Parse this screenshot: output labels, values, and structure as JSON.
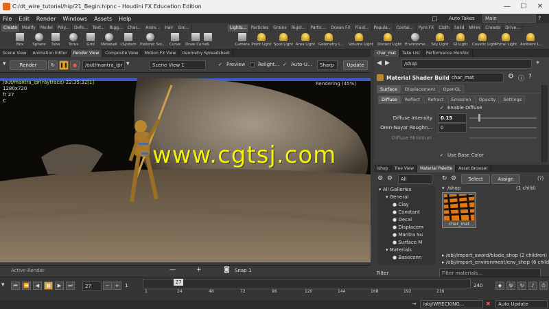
{
  "title": "C:/dt_wire_tutorial/hip/21_Begin.hipnc - Houdini FX Education Edition",
  "menu": [
    "File",
    "Edit",
    "Render",
    "Windows",
    "Assets",
    "Help"
  ],
  "auto_takes": "Auto Takes",
  "desktop": "Main",
  "shelf_tabs_left": [
    "Create",
    "Modify",
    "Model",
    "Poly...",
    "Defo...",
    "Text...",
    "Rigg...",
    "Char...",
    "Anim...",
    "Hair",
    "Gro..."
  ],
  "shelf_tabs_right": [
    "Lights...",
    "Particles",
    "Grains",
    "Rigid...",
    "Partic...",
    "Ocean FX",
    "Fluid...",
    "Popula...",
    "Contai...",
    "Pyro FX",
    "Cloth",
    "Solid",
    "Wires",
    "Crowds",
    "Drive..."
  ],
  "tools_left": [
    "Box",
    "Sphere",
    "Tube",
    "Torus",
    "Grid",
    "Metaball",
    "LSystem",
    "Platonic Sol...",
    "Curve",
    "Draw Curve",
    "S"
  ],
  "tools_right": [
    "Camera",
    "Point Light",
    "Spot Light",
    "Area Light",
    "Geometry L...",
    "Volume Light",
    "Distant Light",
    "Environme...",
    "Sky Light",
    "GI Light",
    "Caustic Light",
    "Portal Light",
    "Ambient L..."
  ],
  "pane_tabs_left": [
    "Scene View",
    "Animation Editor",
    "Render View",
    "Composite View",
    "Motion FX View",
    "Geometry Spreadsheet"
  ],
  "pane_tabs_right": [
    "char_mat",
    "Take List",
    "Performance Monitor"
  ],
  "render_toolbar": {
    "render": "Render",
    "path": "/out/mantra_ipr",
    "view": "Scene View 1",
    "preview": "Preview",
    "relight": "Relight...",
    "auto_update": "Auto-U...",
    "sharp": "Sharp",
    "update": "Update"
  },
  "viewport": {
    "path_line": "/out/mantra_ipr(raytrace)-22:35:32[1]",
    "res": "1280x720",
    "fr": "fr 27",
    "c": "C",
    "rendering": "Rendering (45%)",
    "watermark": "www.cgtsj.com"
  },
  "shop_path": "/shop",
  "material": {
    "type": "Material Shader Builder",
    "name": "char_mat",
    "tabs": [
      "Surface",
      "Displacement",
      "OpenGL"
    ],
    "subtabs": [
      "Diffuse",
      "Reflect",
      "Refract",
      "Emission",
      "Opacity",
      "Settings"
    ],
    "enable_diffuse": "Enable Diffuse",
    "diffuse_intensity_label": "Diffuse Intensity",
    "diffuse_intensity": "0.15",
    "oren_label": "Oren-Nayar Roughn...",
    "oren_value": "0",
    "diffuse_min_label": "Diffuse Minimum",
    "use_base_color": "Use Base Color"
  },
  "lower_tabs": [
    "/shop",
    "Tree View",
    "Material Palette",
    "Asset Browser"
  ],
  "palette": {
    "filter_all": "All",
    "select": "Select",
    "assign": "Assign",
    "help": "(?)",
    "gallery_path": "/shop",
    "child_count": "(1 child)",
    "thumb_label": "char_mat",
    "tree": [
      {
        "label": "All Galleries",
        "indent": 0
      },
      {
        "label": "General",
        "indent": 1
      },
      {
        "label": "Clay",
        "indent": 2
      },
      {
        "label": "Constant",
        "indent": 2
      },
      {
        "label": "Decal",
        "indent": 2
      },
      {
        "label": "Displacem",
        "indent": 2
      },
      {
        "label": "Mantra Su",
        "indent": 2
      },
      {
        "label": "Surface M",
        "indent": 2
      },
      {
        "label": "Materials",
        "indent": 1
      },
      {
        "label": "Baseconn",
        "indent": 2
      }
    ],
    "links": [
      {
        "path": "/obj/import_sword/blade_shop",
        "count": "(2 children)"
      },
      {
        "path": "/obj/import_environment/env_shop",
        "count": "(6 childr"
      }
    ],
    "filter": "Filter",
    "filter_materials": "Filter materials..."
  },
  "active_render": "Active Render",
  "snap": "Snap",
  "snap_value": "1",
  "timeline": {
    "frame": "27",
    "start": "1",
    "end": "240",
    "ticks": [
      "1",
      "24",
      "48",
      "72",
      "96",
      "120",
      "144",
      "168",
      "192",
      "216"
    ]
  },
  "status": {
    "path": "/obj/WRECKING...",
    "auto_update": "Auto Update"
  }
}
